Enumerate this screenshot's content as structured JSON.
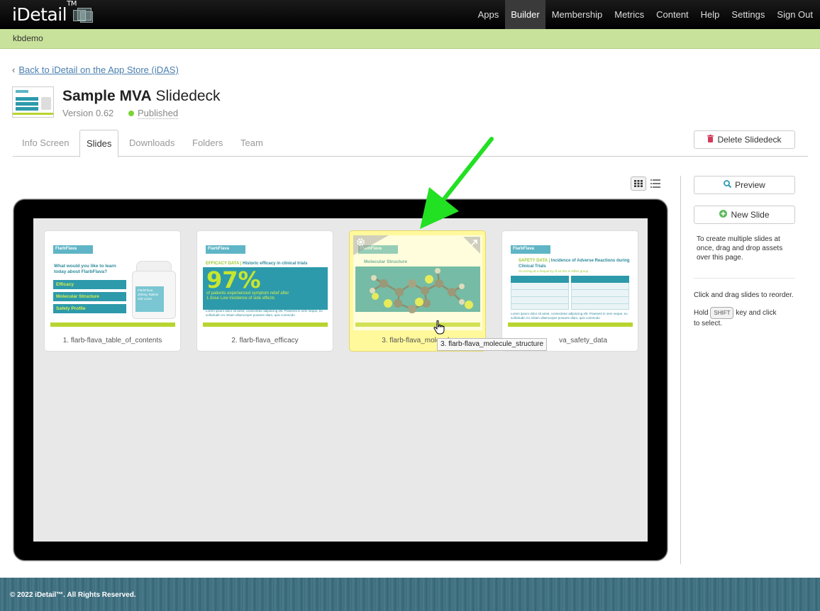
{
  "app": {
    "logo": "iDetail",
    "logo_tm": "TM"
  },
  "nav": [
    {
      "label": "Apps",
      "active": false
    },
    {
      "label": "Builder",
      "active": true
    },
    {
      "label": "Membership",
      "active": false
    },
    {
      "label": "Metrics",
      "active": false
    },
    {
      "label": "Content",
      "active": false
    },
    {
      "label": "Help",
      "active": false
    },
    {
      "label": "Settings",
      "active": false
    },
    {
      "label": "Sign Out",
      "active": false
    }
  ],
  "account": "kbdemo",
  "back_link": "Back to iDetail on the App Store (iDAS)",
  "deck": {
    "title_bold": "Sample MVA",
    "title_rest": "Slidedeck",
    "version": "Version 0.62",
    "status": "Published"
  },
  "tabs": [
    {
      "label": "Info Screen",
      "active": false
    },
    {
      "label": "Slides",
      "active": true
    },
    {
      "label": "Downloads",
      "active": false
    },
    {
      "label": "Folders",
      "active": false
    },
    {
      "label": "Team",
      "active": false
    }
  ],
  "buttons": {
    "delete": "Delete Slidedeck",
    "preview": "Preview",
    "new_slide": "New Slide"
  },
  "sidebar": {
    "drop_note": "To create multiple slides at once, drag and drop assets over this page.",
    "reorder_note": "Click and drag slides to reorder.",
    "hold": "Hold",
    "shift_key": "SHIFT",
    "select_note_a": "key and click",
    "select_note_b": "to select."
  },
  "slides": [
    {
      "caption": "1. flarb-flava_table_of_contents",
      "selected": false,
      "thumb": {
        "brand": "FlarbFlava",
        "heading": "What would you like to learn today about FlarbFlava?",
        "items": [
          "Efficacy",
          "Molecular Structure",
          "Safety Profile"
        ],
        "product": "FlarbFlava 200mg Tablets 100 count"
      }
    },
    {
      "caption": "2. flarb-flava_efficacy",
      "selected": false,
      "thumb": {
        "brand": "FlarbFlava",
        "heading_prefix": "EFFICACY DATA |",
        "heading": "Historic efficacy in clinical trials",
        "stat": "97%",
        "stat_text": "of patients experienced symptom relief after 1 dose Low incidence of side effects",
        "lorem": "Lorem ipsum dolor sit amet, consectetur adipiscing elit. Praesent in sem neque, eu sollicitudin mi. Etiam ullamcorper posuere diam, quis commodo"
      }
    },
    {
      "caption": "3. flarb-flava_molecule_structure",
      "caption_visible": "3. flarb-flava_molecule",
      "selected": true,
      "thumb": {
        "brand": "FlarbFlava",
        "heading": "Molecular Structure"
      }
    },
    {
      "caption": "4. flarb-flava_safety_data",
      "caption_visible": "va_safety_data",
      "selected": false,
      "thumb": {
        "brand": "FlarbFlava",
        "heading_prefix": "SAFETY DATA |",
        "heading": "Incidence of Adverse Reactions during Clinical Trials",
        "sub": "Occurring at a frequency of ≥2.0% in either group",
        "lorem": "Lorem ipsum dolor sit amet, consectetur adipiscing elit. Praesent in sem neque, eu sollicitudin mi. Etiam ullamcorper posuere diam, quis commodo"
      }
    }
  ],
  "tooltip": "3. flarb-flava_molecule_structure",
  "footer": "© 2022 iDetail™.  All Rights Reserved.",
  "colors": {
    "accent_green": "#c9e29b",
    "teal": "#2d9aab",
    "lime": "#b8d430",
    "selected": "#fff99c",
    "arrow": "#22e022"
  }
}
